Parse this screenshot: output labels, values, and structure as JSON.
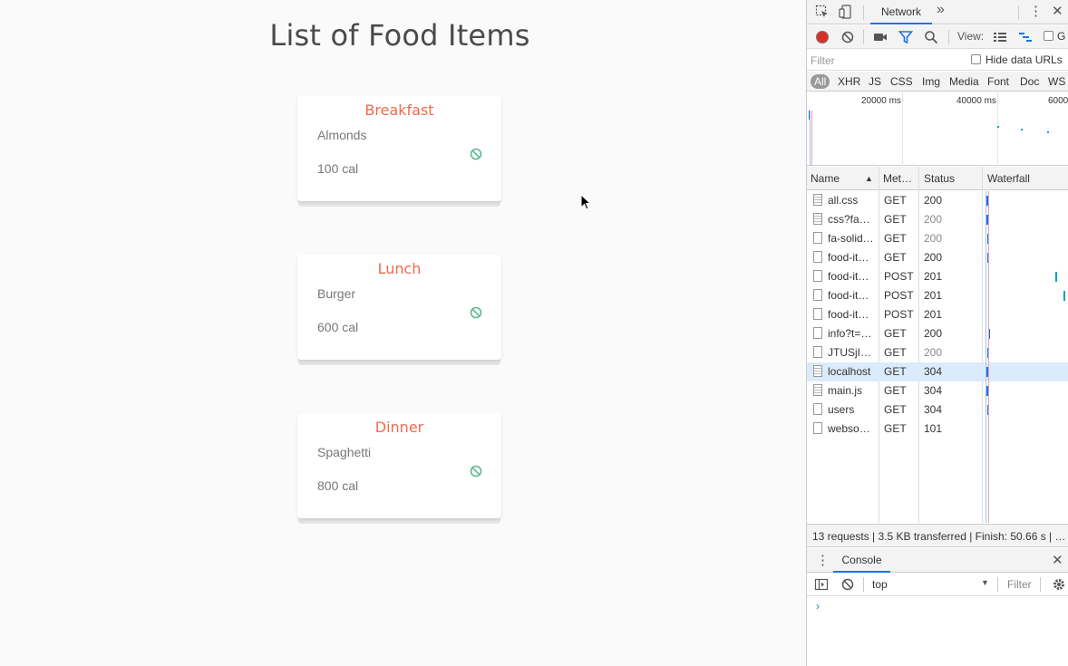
{
  "app": {
    "title": "List of Food Items",
    "cards": [
      {
        "meal": "Breakfast",
        "food": "Almonds",
        "calories": "100 cal"
      },
      {
        "meal": "Lunch",
        "food": "Burger",
        "calories": "600 cal"
      },
      {
        "meal": "Dinner",
        "food": "Spaghetti",
        "calories": "800 cal"
      }
    ],
    "colors": {
      "meal_title": "#ef6a4a",
      "delete_icon": "#5cb88f",
      "text": "#777777"
    }
  },
  "devtools": {
    "tab_network": "Network",
    "more_tabs": "»",
    "menu": "⋮",
    "close": "✕",
    "view_label": "View:",
    "group_label": "G",
    "filter_placeholder": "Filter",
    "hide_data_urls": "Hide data URLs",
    "types": [
      "All",
      "XHR",
      "JS",
      "CSS",
      "Img",
      "Media",
      "Font",
      "Doc",
      "WS"
    ],
    "overview_ticks": [
      "20000 ms",
      "40000 ms",
      "6000"
    ],
    "columns": {
      "name": "Name",
      "method": "Met…",
      "status": "Status",
      "waterfall": "Waterfall",
      "sort_indicator": "▲"
    },
    "requests": [
      {
        "name": "all.css",
        "method": "GET",
        "status": "200"
      },
      {
        "name": "css?fa…",
        "method": "GET",
        "status": "200"
      },
      {
        "name": "fa-solid…",
        "method": "GET",
        "status": "200"
      },
      {
        "name": "food-it…",
        "method": "GET",
        "status": "200"
      },
      {
        "name": "food-it…",
        "method": "POST",
        "status": "201"
      },
      {
        "name": "food-it…",
        "method": "POST",
        "status": "201"
      },
      {
        "name": "food-it…",
        "method": "POST",
        "status": "201"
      },
      {
        "name": "info?t=…",
        "method": "GET",
        "status": "200"
      },
      {
        "name": "JTUSjI…",
        "method": "GET",
        "status": "200"
      },
      {
        "name": "localhost",
        "method": "GET",
        "status": "304"
      },
      {
        "name": "main.js",
        "method": "GET",
        "status": "304"
      },
      {
        "name": "users",
        "method": "GET",
        "status": "304"
      },
      {
        "name": "webso…",
        "method": "GET",
        "status": "101"
      }
    ],
    "summary": "13 requests | 3.5 KB transferred | Finish: 50.66 s | …",
    "console_tab": "Console",
    "console_context": "top",
    "console_filter": "Filter",
    "prompt": "›",
    "colors": {
      "record": "#d93025",
      "accent": "#1a73e8",
      "selected_row": "#dcebfb"
    }
  }
}
